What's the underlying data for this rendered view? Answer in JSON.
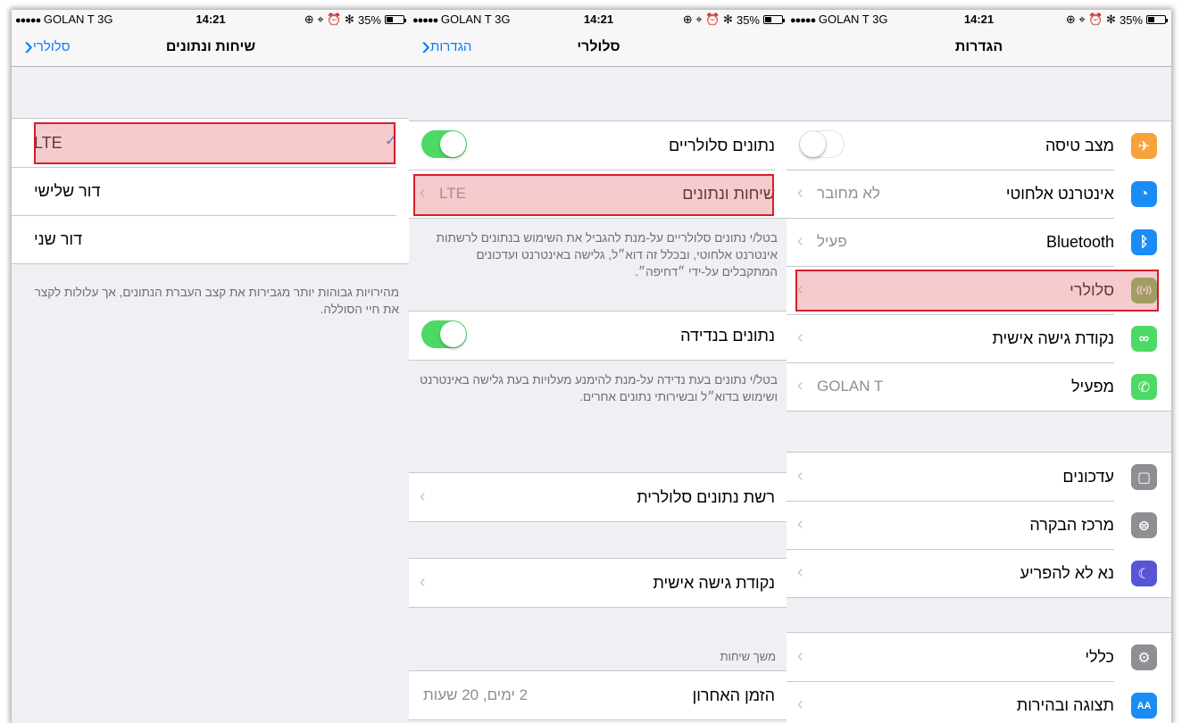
{
  "status": {
    "carrier": "GOLAN T",
    "network": "3G",
    "time": "14:21",
    "battery": "35%",
    "dots": "●●●●●",
    "icons": "⊕ ⌖ ⏰ ✻"
  },
  "panel1": {
    "title": "שיחות ונתונים",
    "back": "סלולרי",
    "options": [
      {
        "label": "LTE",
        "selected": true
      },
      {
        "label": "דור שלישי"
      },
      {
        "label": "דור שני"
      }
    ],
    "footer": "מהירויות גבוהות יותר מגבירות את קצב העברת הנתונים, אך עלולות לקצר את חיי הסוללה."
  },
  "panel2": {
    "title": "סלולרי",
    "back": "הגדרות",
    "cellular_data": "נתונים סלולריים",
    "voice_data": "שיחות ונתונים",
    "voice_data_value": "LTE",
    "footer1": "בטל/י נתונים סלולריים על-מנת להגביל את השימוש בנתונים לרשתות אינטרנט אלחוטי, ובכלל זה דוא״ל, גלישה באינטרנט ועדכונים המתקבלים על-ידי ״דחיפה״.",
    "roaming": "נתונים בנדידה",
    "footer2": "בטל/י נתונים בעת נדידה על-מנת להימנע מעלויות בעת גלישה באינטרנט ושימוש בדוא״ל ובשירותי נתונים אחרים.",
    "network": "רשת נתונים סלולרית",
    "hotspot": "נקודת גישה אישית",
    "calls_header": "משך שיחות",
    "last_time": "הזמן האחרון",
    "last_time_value": "2 ימים, 20 שעות"
  },
  "panel3": {
    "title": "הגדרות",
    "group1": [
      {
        "label": "מצב טיסה",
        "icon": "airplane-icon",
        "glyph": "✈",
        "color": "#f7a33b",
        "value": ""
      },
      {
        "label": "אינטרנט אלחוטי",
        "icon": "wifi-icon",
        "glyph": "◔",
        "color": "#1a8cf5",
        "value": "לא מחובר"
      },
      {
        "label": "Bluetooth",
        "icon": "bluetooth-icon",
        "glyph": "ᛒ",
        "color": "#1a8cf5",
        "value": "פעיל"
      },
      {
        "label": "סלולרי",
        "icon": "cellular-icon",
        "glyph": "((•))",
        "color": "#6fb24a",
        "value": ""
      },
      {
        "label": "נקודת גישה אישית",
        "icon": "hotspot-icon",
        "glyph": "∞",
        "color": "#4cd964",
        "value": ""
      },
      {
        "label": "מפעיל",
        "icon": "phone-icon",
        "glyph": "✆",
        "color": "#4cd964",
        "value": "GOLAN T"
      }
    ],
    "group2": [
      {
        "label": "עדכונים",
        "icon": "notifications-icon",
        "glyph": "▢",
        "color": "#8e8e93"
      },
      {
        "label": "מרכז הבקרה",
        "icon": "control-center-icon",
        "glyph": "⊜",
        "color": "#8e8e93"
      },
      {
        "label": "נא לא להפריע",
        "icon": "moon-icon",
        "glyph": "☾",
        "color": "#5856d6"
      }
    ],
    "group3": [
      {
        "label": "כללי",
        "icon": "gear-icon",
        "glyph": "⚙",
        "color": "#8e8e93"
      },
      {
        "label": "תצוגה ובהירות",
        "icon": "display-icon",
        "glyph": "AA",
        "color": "#1a8cf5"
      }
    ]
  },
  "colors": {
    "accent": "#0a7aff",
    "toggle_on": "#4cd964",
    "highlight_border": "#d41f28"
  }
}
